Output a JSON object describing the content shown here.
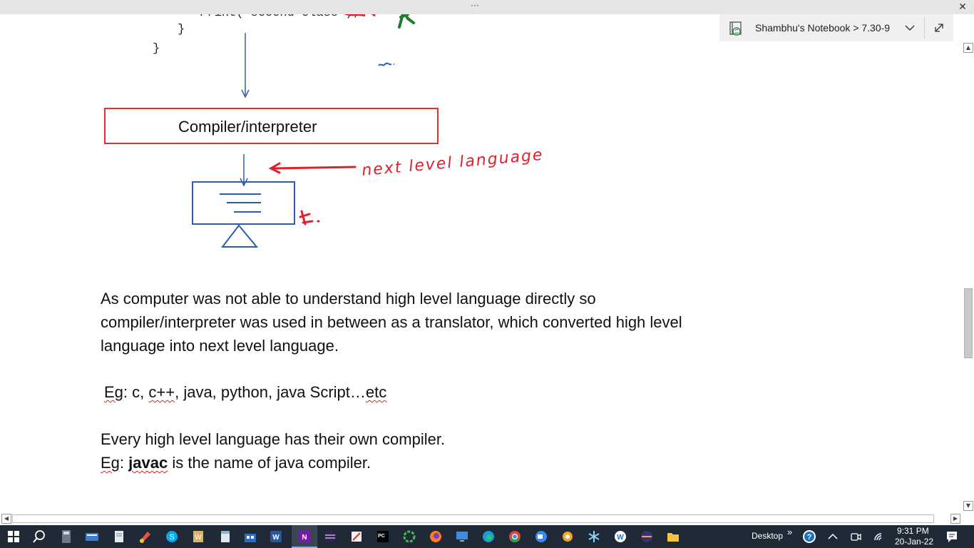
{
  "window": {
    "more_label": "···",
    "close_label": "✕"
  },
  "notebook_bar": {
    "breadcrumb": "Shambhu's Notebook > 7.30-9"
  },
  "code": {
    "line1": "}",
    "line2": "}"
  },
  "diagram": {
    "compiler_box_label": "Compiler/interpreter",
    "annotation_text": "next level language",
    "annotation_color": "#e0202a",
    "arrow_color": "#2a5db0"
  },
  "content": {
    "paragraph1": [
      "As computer was not able to understand high level language directly so",
      "compiler/interpreter was used in between as a translator, which converted high level",
      "language into next level language."
    ],
    "examples": {
      "prefix": "Eg",
      "colon": ":",
      "items_a": " c, ",
      "cpp": "c++",
      "items_b": ", java, python, java Script…",
      "etc": "etc"
    },
    "paragraph2": "Every high level language has their own compiler.",
    "paragraph3": {
      "prefix": "Eg",
      "colon": ": ",
      "bold": "javac",
      "rest": " is the name of java compiler."
    }
  },
  "taskbar": {
    "desktop_label": "Desktop",
    "chevron_label": "»",
    "time": "9:31 PM",
    "date": "20-Jan-22",
    "colors": {
      "background": "#1f2a36",
      "onenote": "#7719aa",
      "word": "#2b579a"
    },
    "icons": [
      "windows-start-icon",
      "search-icon",
      "calculator-icon",
      "keyboard-icon",
      "notepad-icon",
      "paint-icon",
      "skype-icon",
      "wordpad-icon",
      "notes-icon",
      "store-icon",
      "word-icon",
      "onenote-icon",
      "eclipse-icon",
      "snip-icon",
      "pycharm-icon",
      "refresh-icon",
      "firefox-icon",
      "remote-desktop-icon",
      "edge-icon",
      "chrome-icon",
      "zoom-icon",
      "settings-icon",
      "snowflake-icon",
      "webex-icon",
      "ide-icon",
      "file-explorer-icon"
    ]
  }
}
